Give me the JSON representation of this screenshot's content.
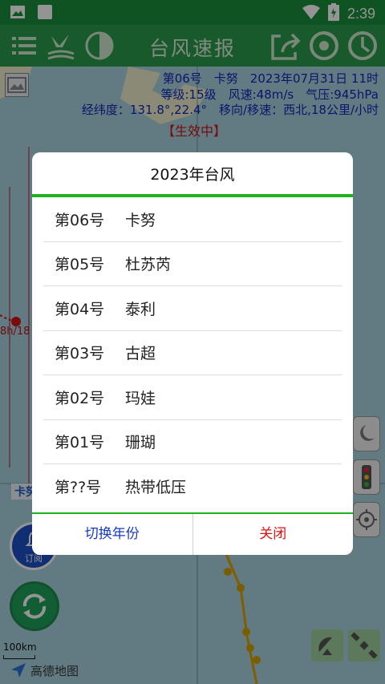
{
  "status_bar": {
    "time": "2:39",
    "icons": [
      "image-icon",
      "square-icon",
      "wifi-icon",
      "battery-icon"
    ]
  },
  "toolbar": {
    "title": "台风速报",
    "left_icons": [
      "menu-icon",
      "bird-icon",
      "half-circle-icon"
    ],
    "right_icons": [
      "share-icon",
      "typhoon-icon",
      "clock-icon"
    ]
  },
  "typhoon_info": {
    "line1": "第06号　卡努　2023年07月31日 11时",
    "line2": "等级:15级　风速:48m/s　气压:945hPa",
    "line3": "经纬度：131.8°,22.4°　移向/移速：西北,18公里/小时",
    "status": "【生效中】"
  },
  "map": {
    "scale_label": "100km",
    "logo_text": "高德地图",
    "subscribe_label": "订阅",
    "track_label_partial": "卡努",
    "side_text": "8h/18"
  },
  "dialog": {
    "title": "2023年台风",
    "items": [
      {
        "num": "第06号",
        "name": "卡努"
      },
      {
        "num": "第05号",
        "name": "杜苏芮"
      },
      {
        "num": "第04号",
        "name": "泰利"
      },
      {
        "num": "第03号",
        "name": "古超"
      },
      {
        "num": "第02号",
        "name": "玛娃"
      },
      {
        "num": "第01号",
        "name": "珊瑚"
      },
      {
        "num": "第??号",
        "name": "热带低压"
      }
    ],
    "switch_label": "切换年份",
    "close_label": "关闭"
  },
  "colors": {
    "accent_green": "#1fb21f",
    "toolbar_green": "#1d8f3b",
    "info_blue": "#1226b8",
    "alert_red": "#d01414"
  }
}
